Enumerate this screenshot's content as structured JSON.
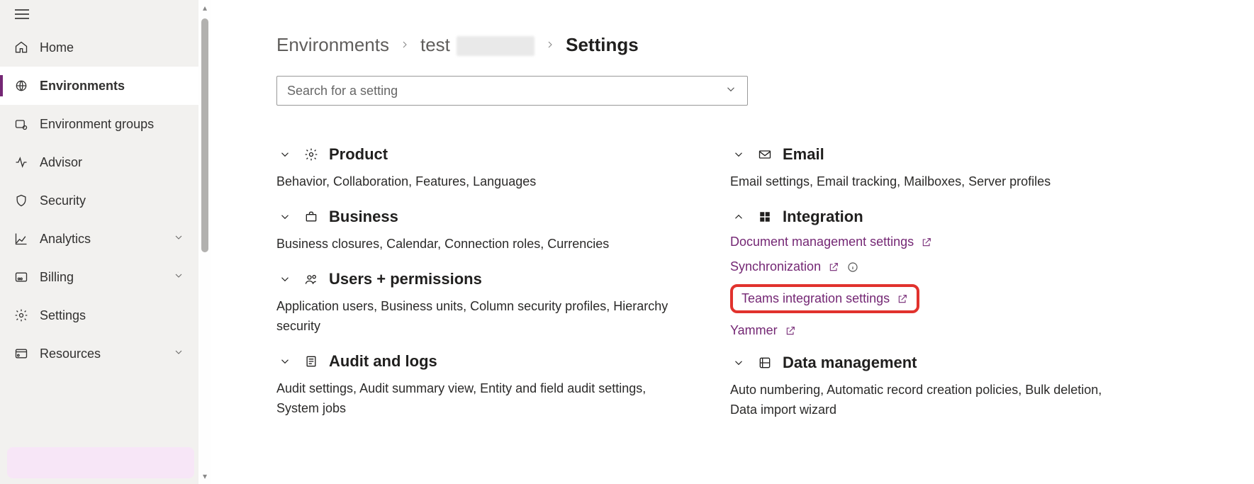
{
  "nav": {
    "items": [
      {
        "label": "Home",
        "icon": "home-icon"
      },
      {
        "label": "Environments",
        "icon": "globe-icon",
        "selected": true
      },
      {
        "label": "Environment groups",
        "icon": "env-group-icon"
      },
      {
        "label": "Advisor",
        "icon": "activity-icon"
      },
      {
        "label": "Security",
        "icon": "shield-icon"
      },
      {
        "label": "Analytics",
        "icon": "chart-icon",
        "chevron": true
      },
      {
        "label": "Billing",
        "icon": "billing-icon",
        "chevron": true
      },
      {
        "label": "Settings",
        "icon": "gear-icon"
      },
      {
        "label": "Resources",
        "icon": "resources-icon",
        "chevron": true
      }
    ]
  },
  "breadcrumb": {
    "root": "Environments",
    "env": "test",
    "current": "Settings"
  },
  "search": {
    "placeholder": "Search for a setting"
  },
  "sections_left": [
    {
      "title": "Product",
      "icon": "gear-icon",
      "summary": "Behavior, Collaboration, Features, Languages"
    },
    {
      "title": "Business",
      "icon": "briefcase-icon",
      "summary": "Business closures, Calendar, Connection roles, Currencies"
    },
    {
      "title": "Users + permissions",
      "icon": "people-icon",
      "summary": "Application users, Business units, Column security profiles, Hierarchy security"
    },
    {
      "title": "Audit and logs",
      "icon": "list-icon",
      "summary": "Audit settings, Audit summary view, Entity and field audit settings, System jobs"
    }
  ],
  "sections_right": [
    {
      "title": "Email",
      "icon": "mail-icon",
      "summary": "Email settings, Email tracking, Mailboxes, Server profiles",
      "expanded": false
    },
    {
      "title": "Integration",
      "icon": "windows-icon",
      "expanded": true,
      "links": [
        {
          "label": "Document management settings",
          "external": true
        },
        {
          "label": "Synchronization",
          "external": true,
          "info": true
        },
        {
          "label": "Teams integration settings",
          "external": true,
          "highlighted": true
        },
        {
          "label": "Yammer",
          "external": true
        }
      ]
    },
    {
      "title": "Data management",
      "icon": "data-icon",
      "summary": "Auto numbering, Automatic record creation policies, Bulk deletion, Data import wizard",
      "expanded": false
    }
  ],
  "colors": {
    "accent": "#742774",
    "highlight_border": "#e1322d"
  }
}
